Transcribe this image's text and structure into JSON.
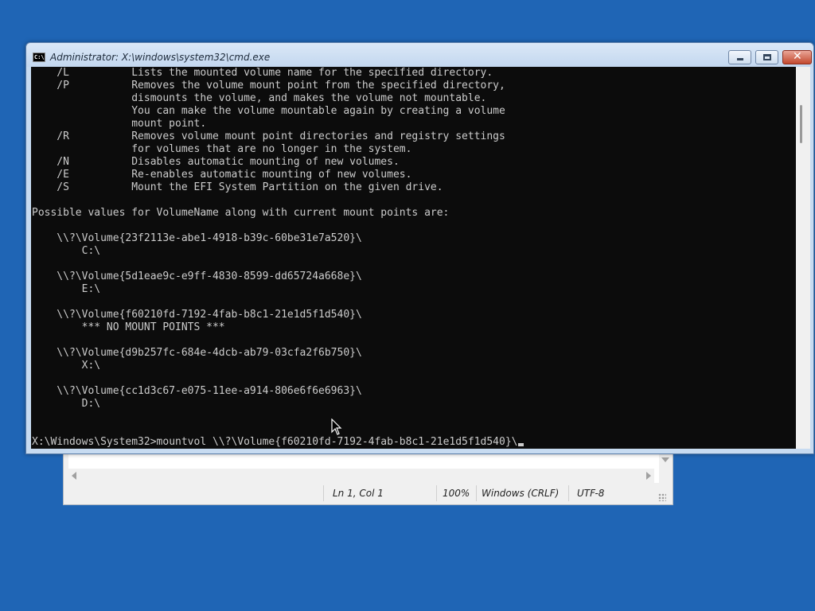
{
  "notepad": {
    "status": {
      "position": "Ln 1, Col 1",
      "zoom": "100%",
      "line_ending": "Windows (CRLF)",
      "encoding": "UTF-8"
    }
  },
  "cmd": {
    "title": "Administrator: X:\\windows\\system32\\cmd.exe",
    "icon_label": "C:\\",
    "console_lines": [
      "    /L          Lists the mounted volume name for the specified directory.",
      "    /P          Removes the volume mount point from the specified directory,",
      "                dismounts the volume, and makes the volume not mountable.",
      "                You can make the volume mountable again by creating a volume",
      "                mount point.",
      "    /R          Removes volume mount point directories and registry settings",
      "                for volumes that are no longer in the system.",
      "    /N          Disables automatic mounting of new volumes.",
      "    /E          Re-enables automatic mounting of new volumes.",
      "    /S          Mount the EFI System Partition on the given drive.",
      "",
      "Possible values for VolumeName along with current mount points are:",
      "",
      "    \\\\?\\Volume{23f2113e-abe1-4918-b39c-60be31e7a520}\\",
      "        C:\\",
      "",
      "    \\\\?\\Volume{5d1eae9c-e9ff-4830-8599-dd65724a668e}\\",
      "        E:\\",
      "",
      "    \\\\?\\Volume{f60210fd-7192-4fab-b8c1-21e1d5f1d540}\\",
      "        *** NO MOUNT POINTS ***",
      "",
      "    \\\\?\\Volume{d9b257fc-684e-4dcb-ab79-03cfa2f6b750}\\",
      "        X:\\",
      "",
      "    \\\\?\\Volume{cc1d3c67-e075-11ee-a914-806e6f6e6963}\\",
      "        D:\\",
      "",
      ""
    ],
    "prompt": "X:\\Windows\\System32>",
    "command": "mountvol \\\\?\\Volume{f60210fd-7192-4fab-b8c1-21e1d5f1d540}\\"
  }
}
